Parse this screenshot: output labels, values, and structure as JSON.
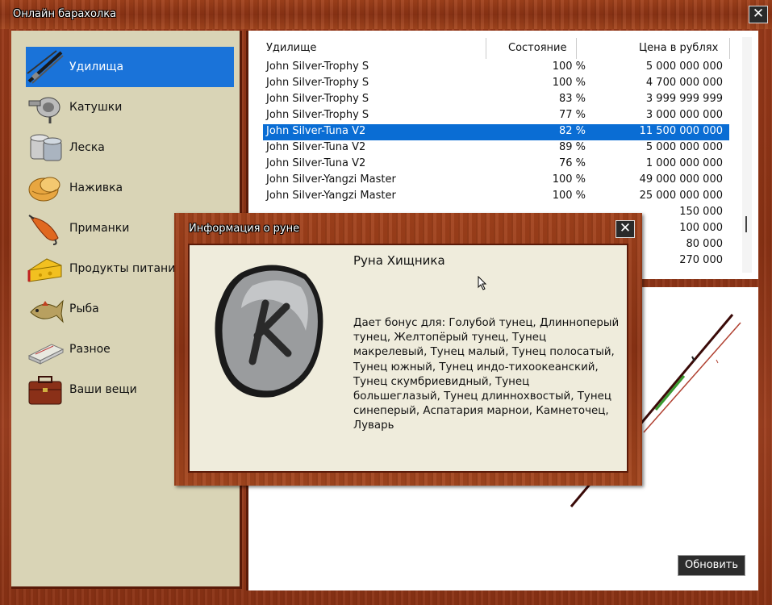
{
  "window": {
    "title": "Онлайн барахолка",
    "close_glyph": "✕"
  },
  "sidebar": {
    "items": [
      {
        "label": "Удилища",
        "icon": "fishing-rod-icon",
        "active": true
      },
      {
        "label": "Катушки",
        "icon": "reel-icon",
        "active": false
      },
      {
        "label": "Леска",
        "icon": "fishing-line-icon",
        "active": false
      },
      {
        "label": "Наживка",
        "icon": "bait-icon",
        "active": false
      },
      {
        "label": "Приманки",
        "icon": "lure-icon",
        "active": false
      },
      {
        "label": "Продукты питания",
        "icon": "cheese-icon",
        "active": false
      },
      {
        "label": "Рыба",
        "icon": "fish-icon",
        "active": false
      },
      {
        "label": "Разное",
        "icon": "misc-icon",
        "active": false
      },
      {
        "label": "Ваши вещи",
        "icon": "briefcase-icon",
        "active": false
      }
    ]
  },
  "table": {
    "columns": [
      "Удилище",
      "Состояние",
      "Цена в рублях"
    ],
    "rows": [
      {
        "name": "John Silver-Trophy S",
        "condition": "100 %",
        "price": "5 000 000 000",
        "selected": false
      },
      {
        "name": "John Silver-Trophy S",
        "condition": "100 %",
        "price": "4 700 000 000",
        "selected": false
      },
      {
        "name": "John Silver-Trophy S",
        "condition": "83 %",
        "price": "3 999 999 999",
        "selected": false
      },
      {
        "name": "John Silver-Trophy S",
        "condition": "77 %",
        "price": "3 000 000 000",
        "selected": false
      },
      {
        "name": "John Silver-Tuna V2",
        "condition": "82 %",
        "price": "11 500 000 000",
        "selected": true
      },
      {
        "name": "John Silver-Tuna V2",
        "condition": "89 %",
        "price": "5 000 000 000",
        "selected": false
      },
      {
        "name": "John Silver-Tuna V2",
        "condition": "76 %",
        "price": "1 000 000 000",
        "selected": false
      },
      {
        "name": "John Silver-Yangzi Master",
        "condition": "100 %",
        "price": "49 000 000 000",
        "selected": false
      },
      {
        "name": "John Silver-Yangzi Master",
        "condition": "100 %",
        "price": "25 000 000 000",
        "selected": false
      },
      {
        "name": "",
        "condition": "",
        "price": "150 000",
        "selected": false
      },
      {
        "name": "",
        "condition": "",
        "price": "100 000",
        "selected": false
      },
      {
        "name": "",
        "condition": "",
        "price": "80 000",
        "selected": false
      },
      {
        "name": "",
        "condition": "",
        "price": "270 000",
        "selected": false
      }
    ]
  },
  "refresh_label": "Обновить",
  "dialog": {
    "title": "Информация о руне",
    "rune_name": "Руна Хищника",
    "description": "Дает бонус для: Голубой тунец, Длинноперый тунец, Желтопёрый тунец, Тунец макрелевый, Тунец малый, Тунец полосатый, Тунец южный, Тунец индо-тихоокеанский, Тунец скумбриевидный, Тунец большеглазый, Тунец длиннохвостый, Тунец синеперый, Аспатария марнои, Камнеточец, Луварь",
    "image_icon": "predator-rune-icon"
  },
  "colors": {
    "accent_selection": "#0a6dd4",
    "sidebar_active": "#1a73d9",
    "panel_bg": "#d9d4b6",
    "wood": "#8c3314"
  }
}
